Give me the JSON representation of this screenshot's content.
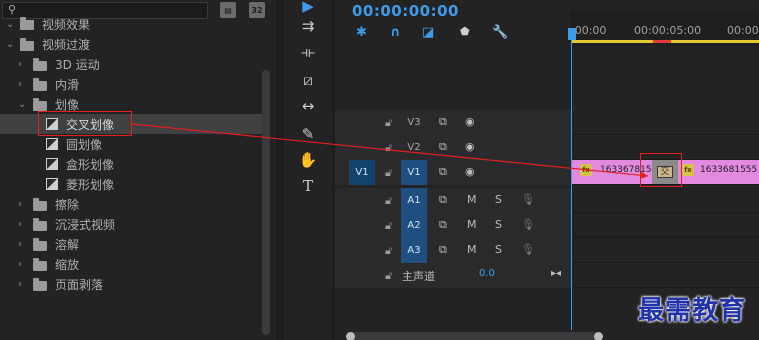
{
  "effects_panel": {
    "toolbar_icons": [
      "new-bin-icon",
      "accelerated-icon",
      "32-bit-icon"
    ],
    "badge_32": "32",
    "items": [
      {
        "label": "视频效果",
        "kind": "folder",
        "expanded": true,
        "level": 0
      },
      {
        "label": "视频过渡",
        "kind": "folder",
        "expanded": true,
        "level": 0
      },
      {
        "label": "3D 运动",
        "kind": "folder",
        "expanded": false,
        "level": 1
      },
      {
        "label": "内滑",
        "kind": "folder",
        "expanded": false,
        "level": 1
      },
      {
        "label": "划像",
        "kind": "folder",
        "expanded": true,
        "level": 1
      },
      {
        "label": "交叉划像",
        "kind": "transition",
        "selected": true,
        "level": 2
      },
      {
        "label": "圆划像",
        "kind": "transition",
        "level": 2
      },
      {
        "label": "盒形划像",
        "kind": "transition",
        "level": 2
      },
      {
        "label": "菱形划像",
        "kind": "transition",
        "level": 2
      },
      {
        "label": "擦除",
        "kind": "folder",
        "expanded": false,
        "level": 1
      },
      {
        "label": "沉浸式视频",
        "kind": "folder",
        "expanded": false,
        "level": 1
      },
      {
        "label": "溶解",
        "kind": "folder",
        "expanded": false,
        "level": 1
      },
      {
        "label": "缩放",
        "kind": "folder",
        "expanded": false,
        "level": 1
      },
      {
        "label": "页面剥落",
        "kind": "folder",
        "expanded": false,
        "level": 1
      }
    ]
  },
  "tools": [
    "selection-tool-icon",
    "track-select-tool-icon",
    "ripple-edit-tool-icon",
    "razor-tool-icon",
    "slip-tool-icon",
    "pen-tool-icon",
    "hand-tool-icon",
    "type-tool-icon"
  ],
  "timeline": {
    "timecode": "00:00:00:00",
    "ruler_labels": [
      ":00:00",
      "00:00:05:00",
      "00:00"
    ],
    "source_patch": "V1",
    "tracks": [
      {
        "id": "V3",
        "type": "video"
      },
      {
        "id": "V2",
        "type": "video"
      },
      {
        "id": "V1",
        "type": "video"
      },
      {
        "id": "A1",
        "type": "audio"
      },
      {
        "id": "A2",
        "type": "audio"
      },
      {
        "id": "A3",
        "type": "audio"
      }
    ],
    "audio_btns": {
      "mute": "M",
      "solo": "S"
    },
    "master": {
      "label": "主声道",
      "value": "0.0"
    },
    "clips": [
      {
        "name": "1633678155",
        "track": "V1"
      },
      {
        "name": "1633681555",
        "track": "V1"
      }
    ],
    "transition_glyph": "交"
  },
  "watermark": "最需教育",
  "colors": {
    "accent": "#3d9bea",
    "clip": "#e28ae0",
    "highlight": "#e02020",
    "watermark": "#2233aa"
  }
}
